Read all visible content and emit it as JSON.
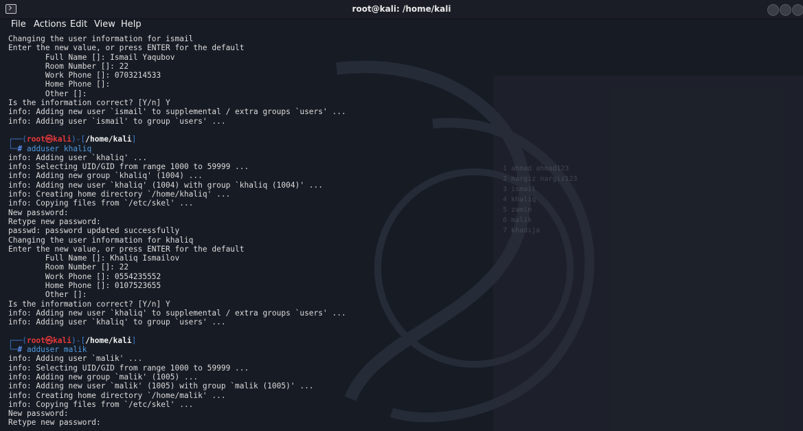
{
  "window": {
    "title": "root@kali: /home/kali"
  },
  "menu": [
    "File",
    "Actions",
    "Edit",
    "View",
    "Help"
  ],
  "terminal_lines": [
    {
      "t": "text",
      "v": "Changing the user information for ismail"
    },
    {
      "t": "text",
      "v": "Enter the new value, or press ENTER for the default"
    },
    {
      "t": "text",
      "v": "        Full Name []: Ismail Yaqubov"
    },
    {
      "t": "text",
      "v": "        Room Number []: 22"
    },
    {
      "t": "text",
      "v": "        Work Phone []: 0703214533"
    },
    {
      "t": "text",
      "v": "        Home Phone []:"
    },
    {
      "t": "text",
      "v": "        Other []:"
    },
    {
      "t": "text",
      "v": "Is the information correct? [Y/n] Y"
    },
    {
      "t": "text",
      "v": "info: Adding new user `ismail' to supplemental / extra groups `users' ..."
    },
    {
      "t": "text",
      "v": "info: Adding user `ismail' to group `users' ..."
    },
    {
      "t": "text",
      "v": ""
    },
    {
      "t": "prompt",
      "user": "root㉿kali",
      "path": "/home/kali"
    },
    {
      "t": "cmd",
      "v": "adduser khaliq"
    },
    {
      "t": "text",
      "v": "info: Adding user `khaliq' ..."
    },
    {
      "t": "text",
      "v": "info: Selecting UID/GID from range 1000 to 59999 ..."
    },
    {
      "t": "text",
      "v": "info: Adding new group `khaliq' (1004) ..."
    },
    {
      "t": "text",
      "v": "info: Adding new user `khaliq' (1004) with group `khaliq (1004)' ..."
    },
    {
      "t": "text",
      "v": "info: Creating home directory `/home/khaliq' ..."
    },
    {
      "t": "text",
      "v": "info: Copying files from `/etc/skel' ..."
    },
    {
      "t": "text",
      "v": "New password:"
    },
    {
      "t": "text",
      "v": "Retype new password:"
    },
    {
      "t": "text",
      "v": "passwd: password updated successfully"
    },
    {
      "t": "text",
      "v": "Changing the user information for khaliq"
    },
    {
      "t": "text",
      "v": "Enter the new value, or press ENTER for the default"
    },
    {
      "t": "text",
      "v": "        Full Name []: Khaliq Ismailov"
    },
    {
      "t": "text",
      "v": "        Room Number []: 22"
    },
    {
      "t": "text",
      "v": "        Work Phone []: 0554235552"
    },
    {
      "t": "text",
      "v": "        Home Phone []: 0107523655"
    },
    {
      "t": "text",
      "v": "        Other []:"
    },
    {
      "t": "text",
      "v": "Is the information correct? [Y/n] Y"
    },
    {
      "t": "text",
      "v": "info: Adding new user `khaliq' to supplemental / extra groups `users' ..."
    },
    {
      "t": "text",
      "v": "info: Adding user `khaliq' to group `users' ..."
    },
    {
      "t": "text",
      "v": ""
    },
    {
      "t": "prompt",
      "user": "root㉿kali",
      "path": "/home/kali"
    },
    {
      "t": "cmd",
      "v": "adduser malik"
    },
    {
      "t": "text",
      "v": "info: Adding user `malik' ..."
    },
    {
      "t": "text",
      "v": "info: Selecting UID/GID from range 1000 to 59999 ..."
    },
    {
      "t": "text",
      "v": "info: Adding new group `malik' (1005) ..."
    },
    {
      "t": "text",
      "v": "info: Adding new user `malik' (1005) with group `malik (1005)' ..."
    },
    {
      "t": "text",
      "v": "info: Creating home directory `/home/malik' ..."
    },
    {
      "t": "text",
      "v": "info: Copying files from `/etc/skel' ..."
    },
    {
      "t": "text",
      "v": "New password:"
    },
    {
      "t": "text",
      "v": "Retype new password:"
    }
  ],
  "background_ghost": [
    "1 ahmad ahmad123",
    "2 nargiz nargiz123",
    "3 ismail",
    "4 khaliq",
    "5 zamin",
    "6 malik",
    "7 khadija"
  ],
  "colors": {
    "background": "#171b24",
    "prompt_frame": "#3b7ac9",
    "prompt_user": "#e5383b",
    "command": "#4f9be0"
  },
  "icons": {
    "app": "terminal-icon",
    "minimize": "minimize-icon",
    "maximize": "maximize-icon",
    "close": "close-icon"
  }
}
